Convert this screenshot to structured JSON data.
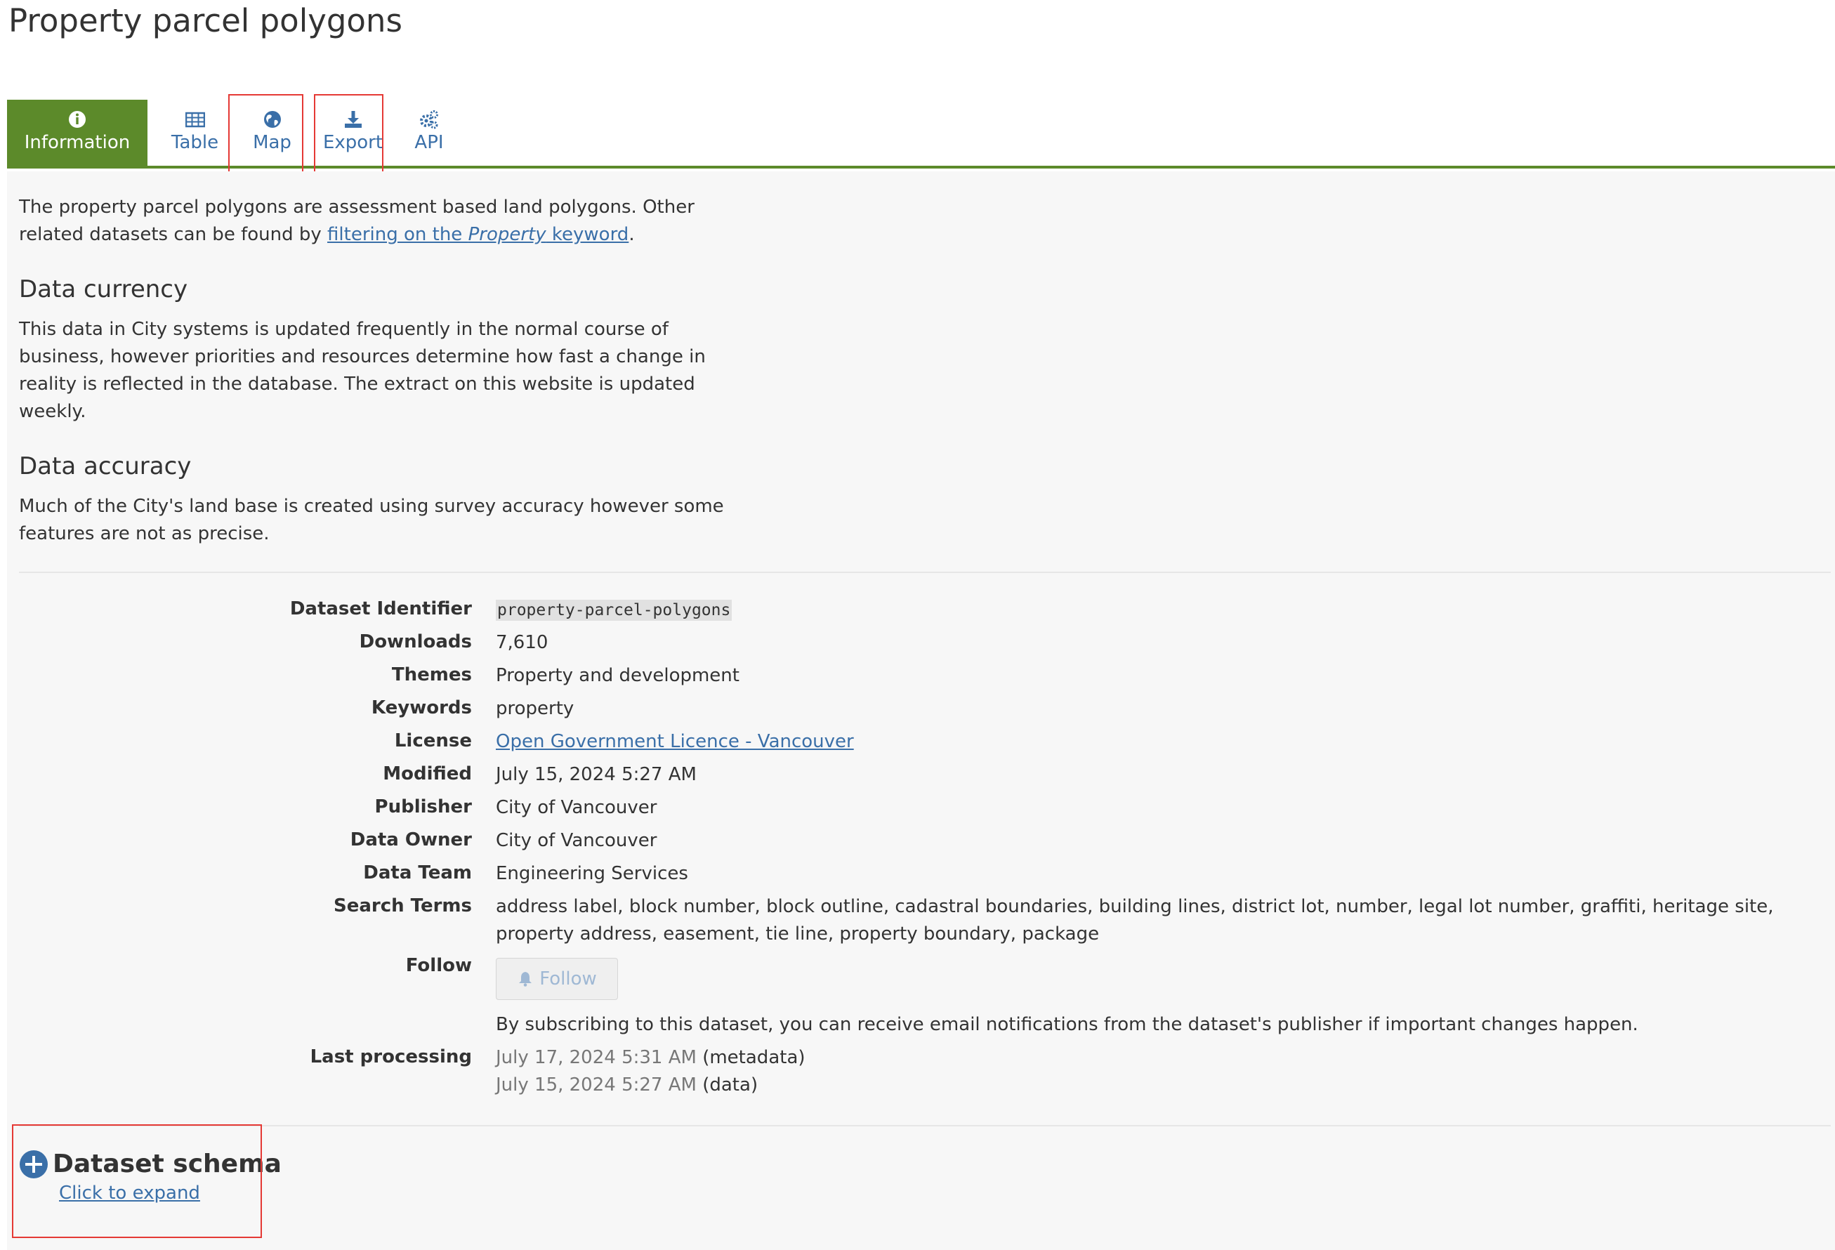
{
  "page": {
    "title": "Property parcel polygons"
  },
  "tabs": [
    {
      "label": "Information",
      "icon": "info-icon",
      "active": true
    },
    {
      "label": "Table",
      "icon": "table-icon"
    },
    {
      "label": "Map",
      "icon": "globe-icon"
    },
    {
      "label": "Export",
      "icon": "download-icon"
    },
    {
      "label": "API",
      "icon": "cogs-icon"
    }
  ],
  "intro": {
    "text_before": "The property parcel polygons are assessment based land polygons. Other related datasets can be found by ",
    "link_part1": "filtering on the ",
    "link_em": "Property",
    "link_part2": " keyword",
    "text_after": "."
  },
  "sections": {
    "currency_title": "Data currency",
    "currency_text": "This data in City systems is updated frequently in the normal course of business, however priorities and resources determine how fast a change in reality is reflected in the database.  The extract on this website is updated weekly.",
    "accuracy_title": "Data accuracy",
    "accuracy_text": "Much of the City's land base is created using survey accuracy however some features are not as precise."
  },
  "metadata": {
    "identifier": {
      "label": "Dataset Identifier",
      "value": "property-parcel-polygons"
    },
    "downloads": {
      "label": "Downloads",
      "value": "7,610"
    },
    "themes": {
      "label": "Themes",
      "value": "Property and development"
    },
    "keywords": {
      "label": "Keywords",
      "value": "property"
    },
    "license": {
      "label": "License",
      "value": "Open Government Licence - Vancouver"
    },
    "modified": {
      "label": "Modified",
      "value": "July 15, 2024 5:27 AM"
    },
    "publisher": {
      "label": "Publisher",
      "value": "City of Vancouver"
    },
    "owner": {
      "label": "Data Owner",
      "value": "City of Vancouver"
    },
    "team": {
      "label": "Data Team",
      "value": "Engineering Services"
    },
    "search_terms": {
      "label": "Search Terms",
      "value": "address label, block number, block outline, cadastral boundaries, building lines, district lot, number, legal lot number, graffiti, heritage site, property address, easement, tie line, property boundary, package"
    },
    "follow": {
      "label": "Follow",
      "button": "Follow",
      "note": "By subscribing to this dataset, you can receive email notifications from the dataset's publisher if important changes happen."
    },
    "last_processing": {
      "label": "Last processing",
      "metadata_date": "July 17, 2024 5:31 AM",
      "metadata_tag": "metadata",
      "data_date": "July 15, 2024 5:27 AM",
      "data_tag": "data"
    }
  },
  "schema": {
    "title": "Dataset schema",
    "expand": "Click to expand",
    "icon": "plus-circle-icon"
  },
  "colors": {
    "accent_green": "#5c8a2a",
    "link_blue": "#3a6fa8",
    "highlight_red": "#e53935"
  }
}
